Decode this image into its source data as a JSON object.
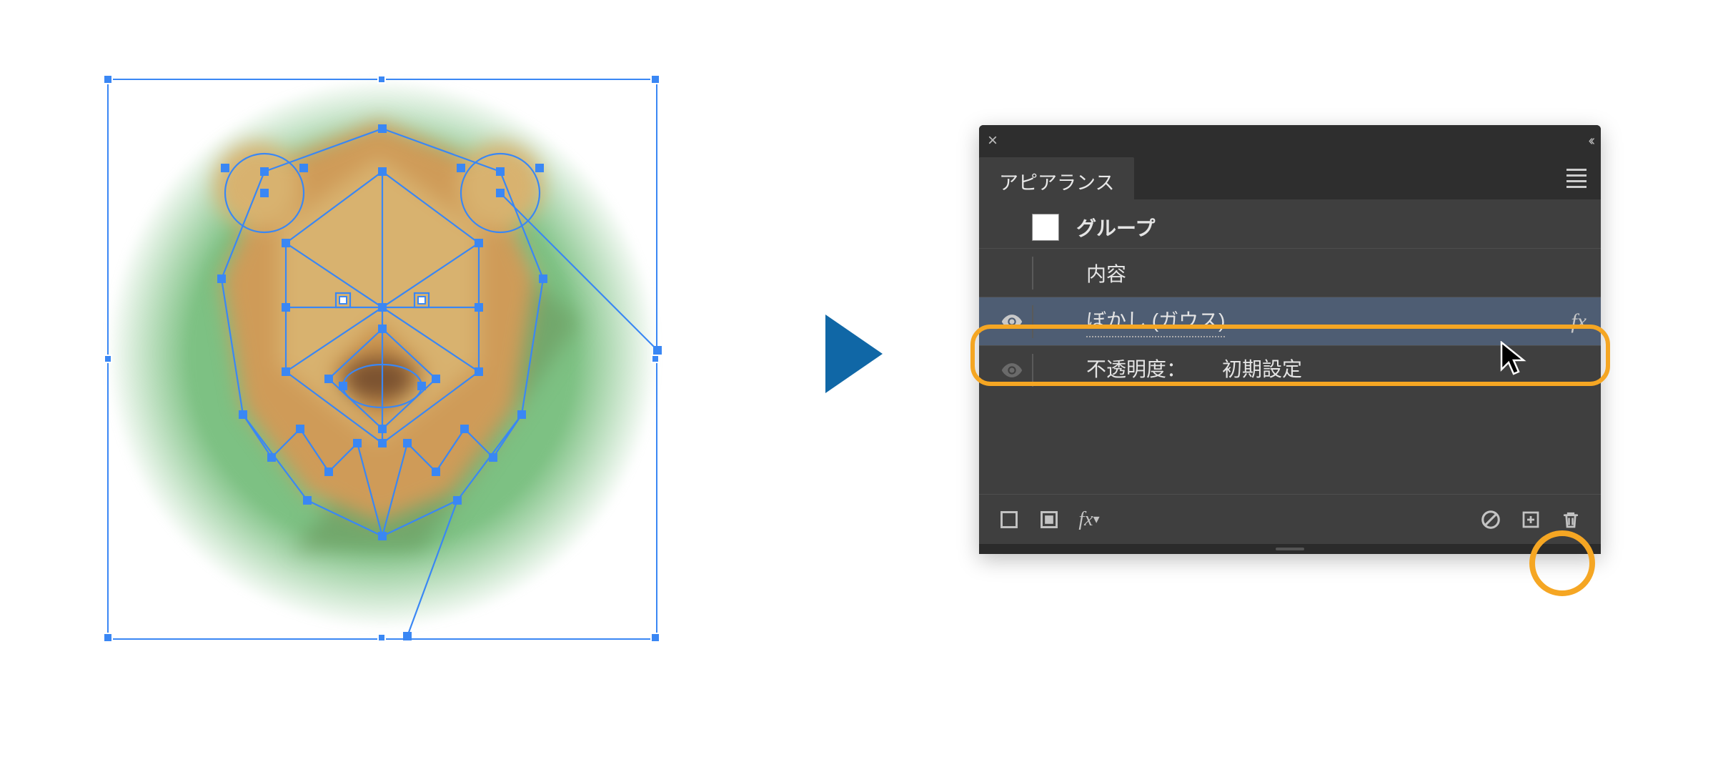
{
  "panel": {
    "title_tab": "アピアランス",
    "rows": {
      "group": "グループ",
      "contents": "内容",
      "blur": "ぼかし (ガウス)",
      "opacity_label": "不透明度：",
      "opacity_value": "初期設定",
      "fx_text": "fx"
    },
    "footer": {
      "fx_text": "fx"
    }
  },
  "highlight_color": "#f5a623",
  "selection_color": "#3a87f4"
}
